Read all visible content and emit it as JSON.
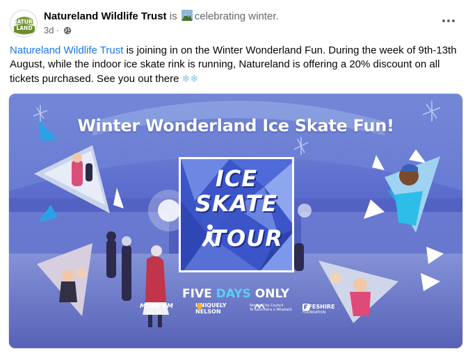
{
  "post": {
    "page_name": "Natureland Wildlife Trust",
    "is_word": "is",
    "activity": "celebrating winter.",
    "timestamp": "3d",
    "separator": "·",
    "avatar_text_top": "NATURE",
    "avatar_text_bottom": "LAND",
    "body_mention": "Natureland Wildlife Trust",
    "body_text": " is joining in on the Winter Wonderland Fun. During the week of 9th-13th August, while the indoor ice skate rink is running, Natureland is offering a 20% discount on all tickets purchased. See you out there ",
    "body_emoji": "❄❄"
  },
  "image": {
    "title": "Winter Wonderland Ice Skate Fun!",
    "logo_line1": "ICE",
    "logo_line2": "SKATE",
    "logo_line3": "TOUR",
    "tagline_part1": "FIVE ",
    "tagline_part2": "DAYS",
    "tagline_part3": " ONLY",
    "sponsors": {
      "more_fm": "MORE FM",
      "nelson_line1": "UNIQUELY",
      "nelson_line2": "NELSON",
      "council_line1": "Nelson City Council",
      "council_line2": "Te Kaunihera o Whakatū",
      "fifeshire_line1": "FIFESHIRE",
      "fifeshire_line2": "FOUNDATION"
    }
  },
  "colors": {
    "link": "#1877f2",
    "secondary_text": "#65676b",
    "tagline_accent": "#58d0f5"
  },
  "icons": [
    "globe-icon",
    "more-options-icon",
    "activity-icon",
    "snowflake-icon"
  ]
}
